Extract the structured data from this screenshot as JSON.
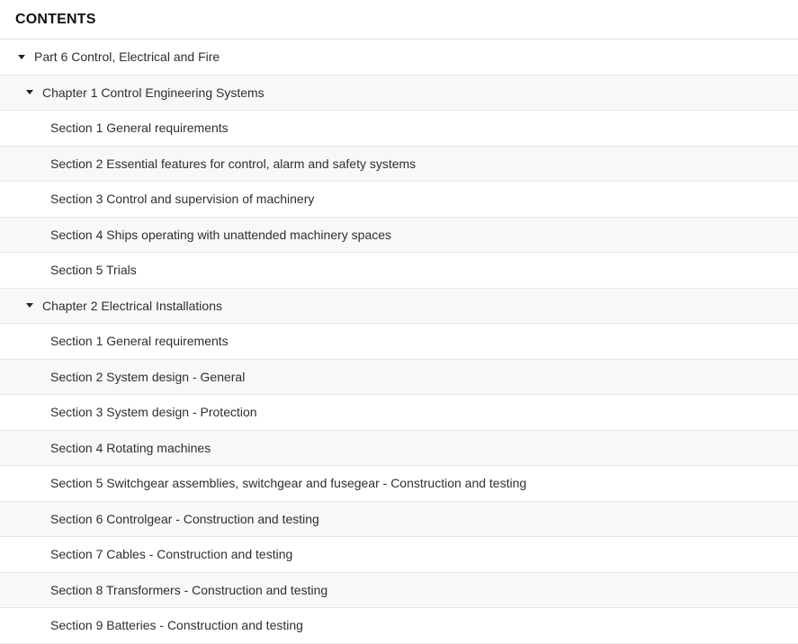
{
  "header": {
    "title": "CONTENTS"
  },
  "toc": {
    "part": {
      "label": "Part 6 Control, Electrical and Fire"
    },
    "chapter1": {
      "label": "Chapter 1 Control Engineering Systems",
      "sections": [
        "Section 1 General requirements",
        "Section 2 Essential features for control, alarm and safety systems",
        "Section 3 Control and supervision of machinery",
        "Section 4 Ships operating with unattended machinery spaces",
        "Section 5 Trials"
      ]
    },
    "chapter2": {
      "label": "Chapter 2 Electrical Installations",
      "sections": [
        "Section 1 General requirements",
        "Section 2 System design - General",
        "Section 3 System design - Protection",
        "Section 4 Rotating machines",
        "Section 5 Switchgear assemblies, switchgear and fusegear - Construction and testing",
        "Section 6 Controlgear - Construction and testing",
        "Section 7 Cables - Construction and testing",
        "Section 8 Transformers - Construction and testing",
        "Section 9 Batteries - Construction and testing"
      ]
    }
  },
  "icons": {
    "expand": "caret-down-icon"
  },
  "colors": {
    "row_alt_bg": "#f8f8f8",
    "divider": "#e6e6e6",
    "text": "#2f2f2f"
  }
}
